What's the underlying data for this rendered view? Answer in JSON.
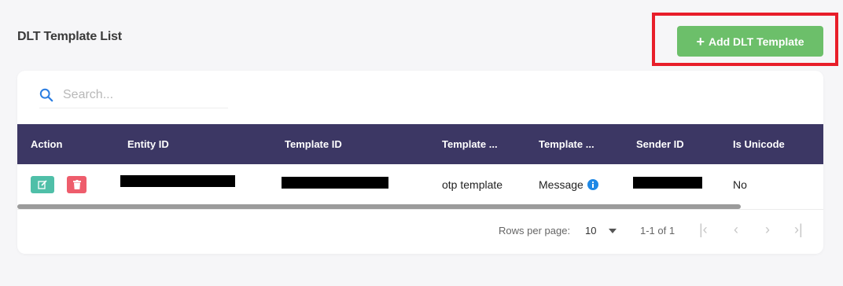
{
  "header": {
    "title": "DLT Template List",
    "add_button_label": "Add DLT Template",
    "highlight_color": "#e81e2a",
    "add_button_color": "#6cbf6a"
  },
  "search": {
    "placeholder": "Search...",
    "value": ""
  },
  "table": {
    "header_color": "#3c3764",
    "columns": [
      "Action",
      "Entity ID",
      "Template ID",
      "Template ...",
      "Template ...",
      "Sender ID",
      "Is Unicode"
    ],
    "rows": [
      {
        "entity_id": "[redacted]",
        "template_id": "[redacted]",
        "template_name": "otp template",
        "template_type": "Message",
        "sender_id": "[redacted]",
        "is_unicode": "No"
      }
    ]
  },
  "pagination": {
    "rows_per_page_label": "Rows per page:",
    "rows_per_page": "10",
    "range": "1-1 of 1"
  },
  "icons": {
    "search": "search-icon",
    "edit": "edit-icon",
    "delete": "trash-icon",
    "info": "info-icon",
    "first": "first-page-icon",
    "prev": "prev-page-icon",
    "next": "next-page-icon",
    "last": "last-page-icon"
  }
}
